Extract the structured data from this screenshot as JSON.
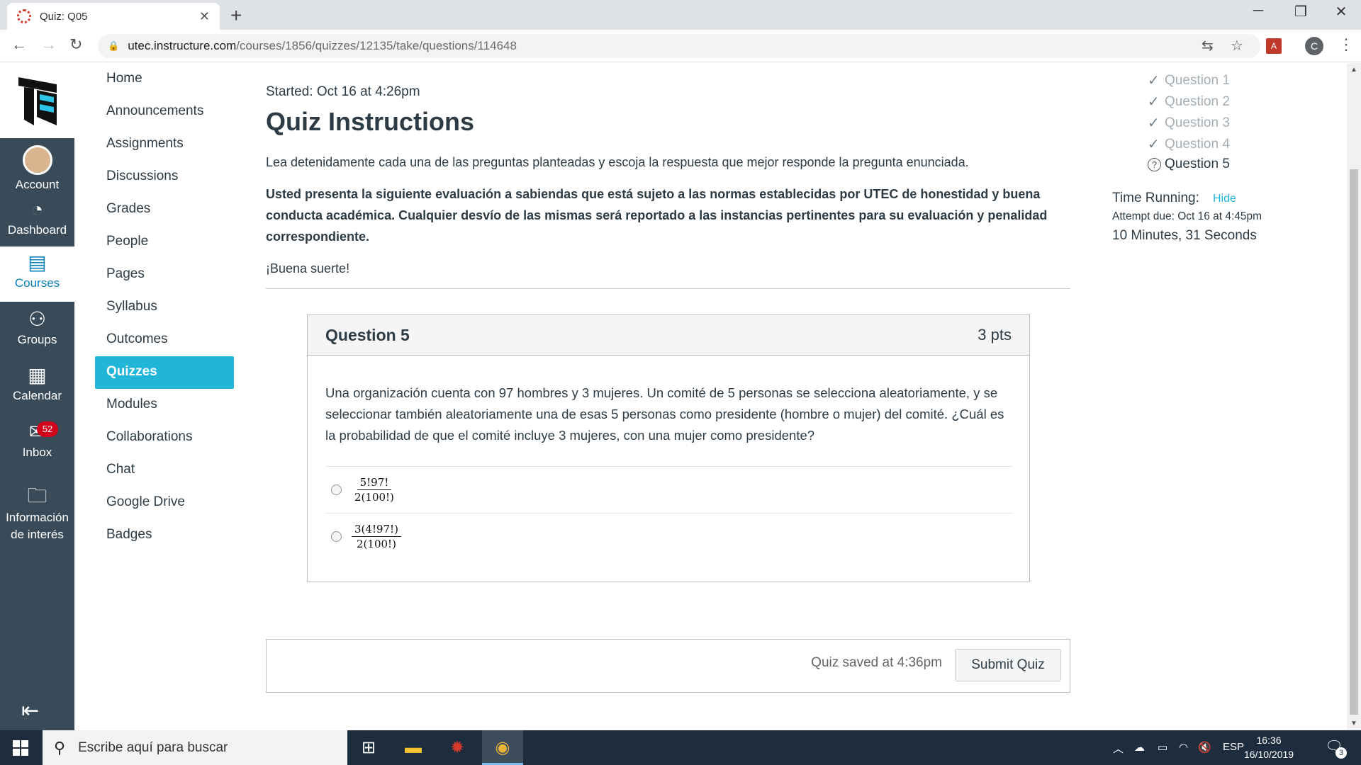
{
  "browser": {
    "tab_title": "Quiz: Q05",
    "url_host": "utec.instructure.com",
    "url_path": "/courses/1856/quizzes/12135/take/questions/114648",
    "profile_initial": "C"
  },
  "global_nav": {
    "items": [
      {
        "label": "Account",
        "icon": "avatar"
      },
      {
        "label": "Dashboard",
        "icon": "dashboard-icon"
      },
      {
        "label": "Courses",
        "icon": "courses-icon"
      },
      {
        "label": "Groups",
        "icon": "groups-icon"
      },
      {
        "label": "Calendar",
        "icon": "calendar-icon"
      },
      {
        "label": "Inbox",
        "icon": "inbox-icon",
        "badge": "52"
      },
      {
        "label": "Información de interés",
        "icon": "folder-icon"
      }
    ]
  },
  "course_nav": {
    "items": [
      "Home",
      "Announcements",
      "Assignments",
      "Discussions",
      "Grades",
      "People",
      "Pages",
      "Syllabus",
      "Outcomes",
      "Quizzes",
      "Modules",
      "Collaborations",
      "Chat",
      "Google Drive",
      "Badges"
    ],
    "active": "Quizzes"
  },
  "quiz": {
    "started": "Started: Oct 16 at 4:26pm",
    "title": "Quiz Instructions",
    "instruction_1": "Lea detenidamente cada una de las preguntas planteadas y escoja la respuesta que mejor responde la pregunta enunciada.",
    "instruction_2": "Usted presenta la siguiente evaluación a sabiendas que está sujeto a las normas establecidas por UTEC de honestidad y buena conducta académica. Cualquier desvío de las mismas será reportado a las instancias pertinentes para su evaluación y penalidad correspondiente.",
    "instruction_3": "¡Buena suerte!",
    "question": {
      "title": "Question 5",
      "points": "3 pts",
      "text": "Una organización cuenta con 97 hombres y 3 mujeres. Un comité de 5 personas se selecciona aleatoriamente, y se seleccionar también aleatoriamente una de esas 5 personas como presidente (hombre o mujer) del comité. ¿Cuál es la probabilidad de que el comité incluye 3 mujeres, con una mujer como presidente?",
      "answers": [
        {
          "numerator": "5!97!",
          "denominator": "2(100!)"
        },
        {
          "numerator": "3(4!97!)",
          "denominator": "2(100!)"
        }
      ]
    },
    "saved_text": "Quiz saved at 4:36pm",
    "submit_label": "Submit Quiz"
  },
  "sidebar": {
    "questions": [
      {
        "label": "Question 1",
        "answered": true
      },
      {
        "label": "Question 2",
        "answered": true
      },
      {
        "label": "Question 3",
        "answered": true
      },
      {
        "label": "Question 4",
        "answered": true
      },
      {
        "label": "Question 5",
        "answered": false,
        "current": true
      }
    ],
    "time_running_label": "Time Running:",
    "hide_label": "Hide",
    "attempt_due": "Attempt due: Oct 16 at 4:45pm",
    "time_left": "10 Minutes, 31 Seconds"
  },
  "taskbar": {
    "search_placeholder": "Escribe aquí para buscar",
    "language": "ESP",
    "time": "16:36",
    "date": "16/10/2019",
    "notifications": "3"
  },
  "colors": {
    "accent": "#21b6d8",
    "global_nav_bg": "#394b58",
    "inbox_badge": "#d0021b"
  }
}
